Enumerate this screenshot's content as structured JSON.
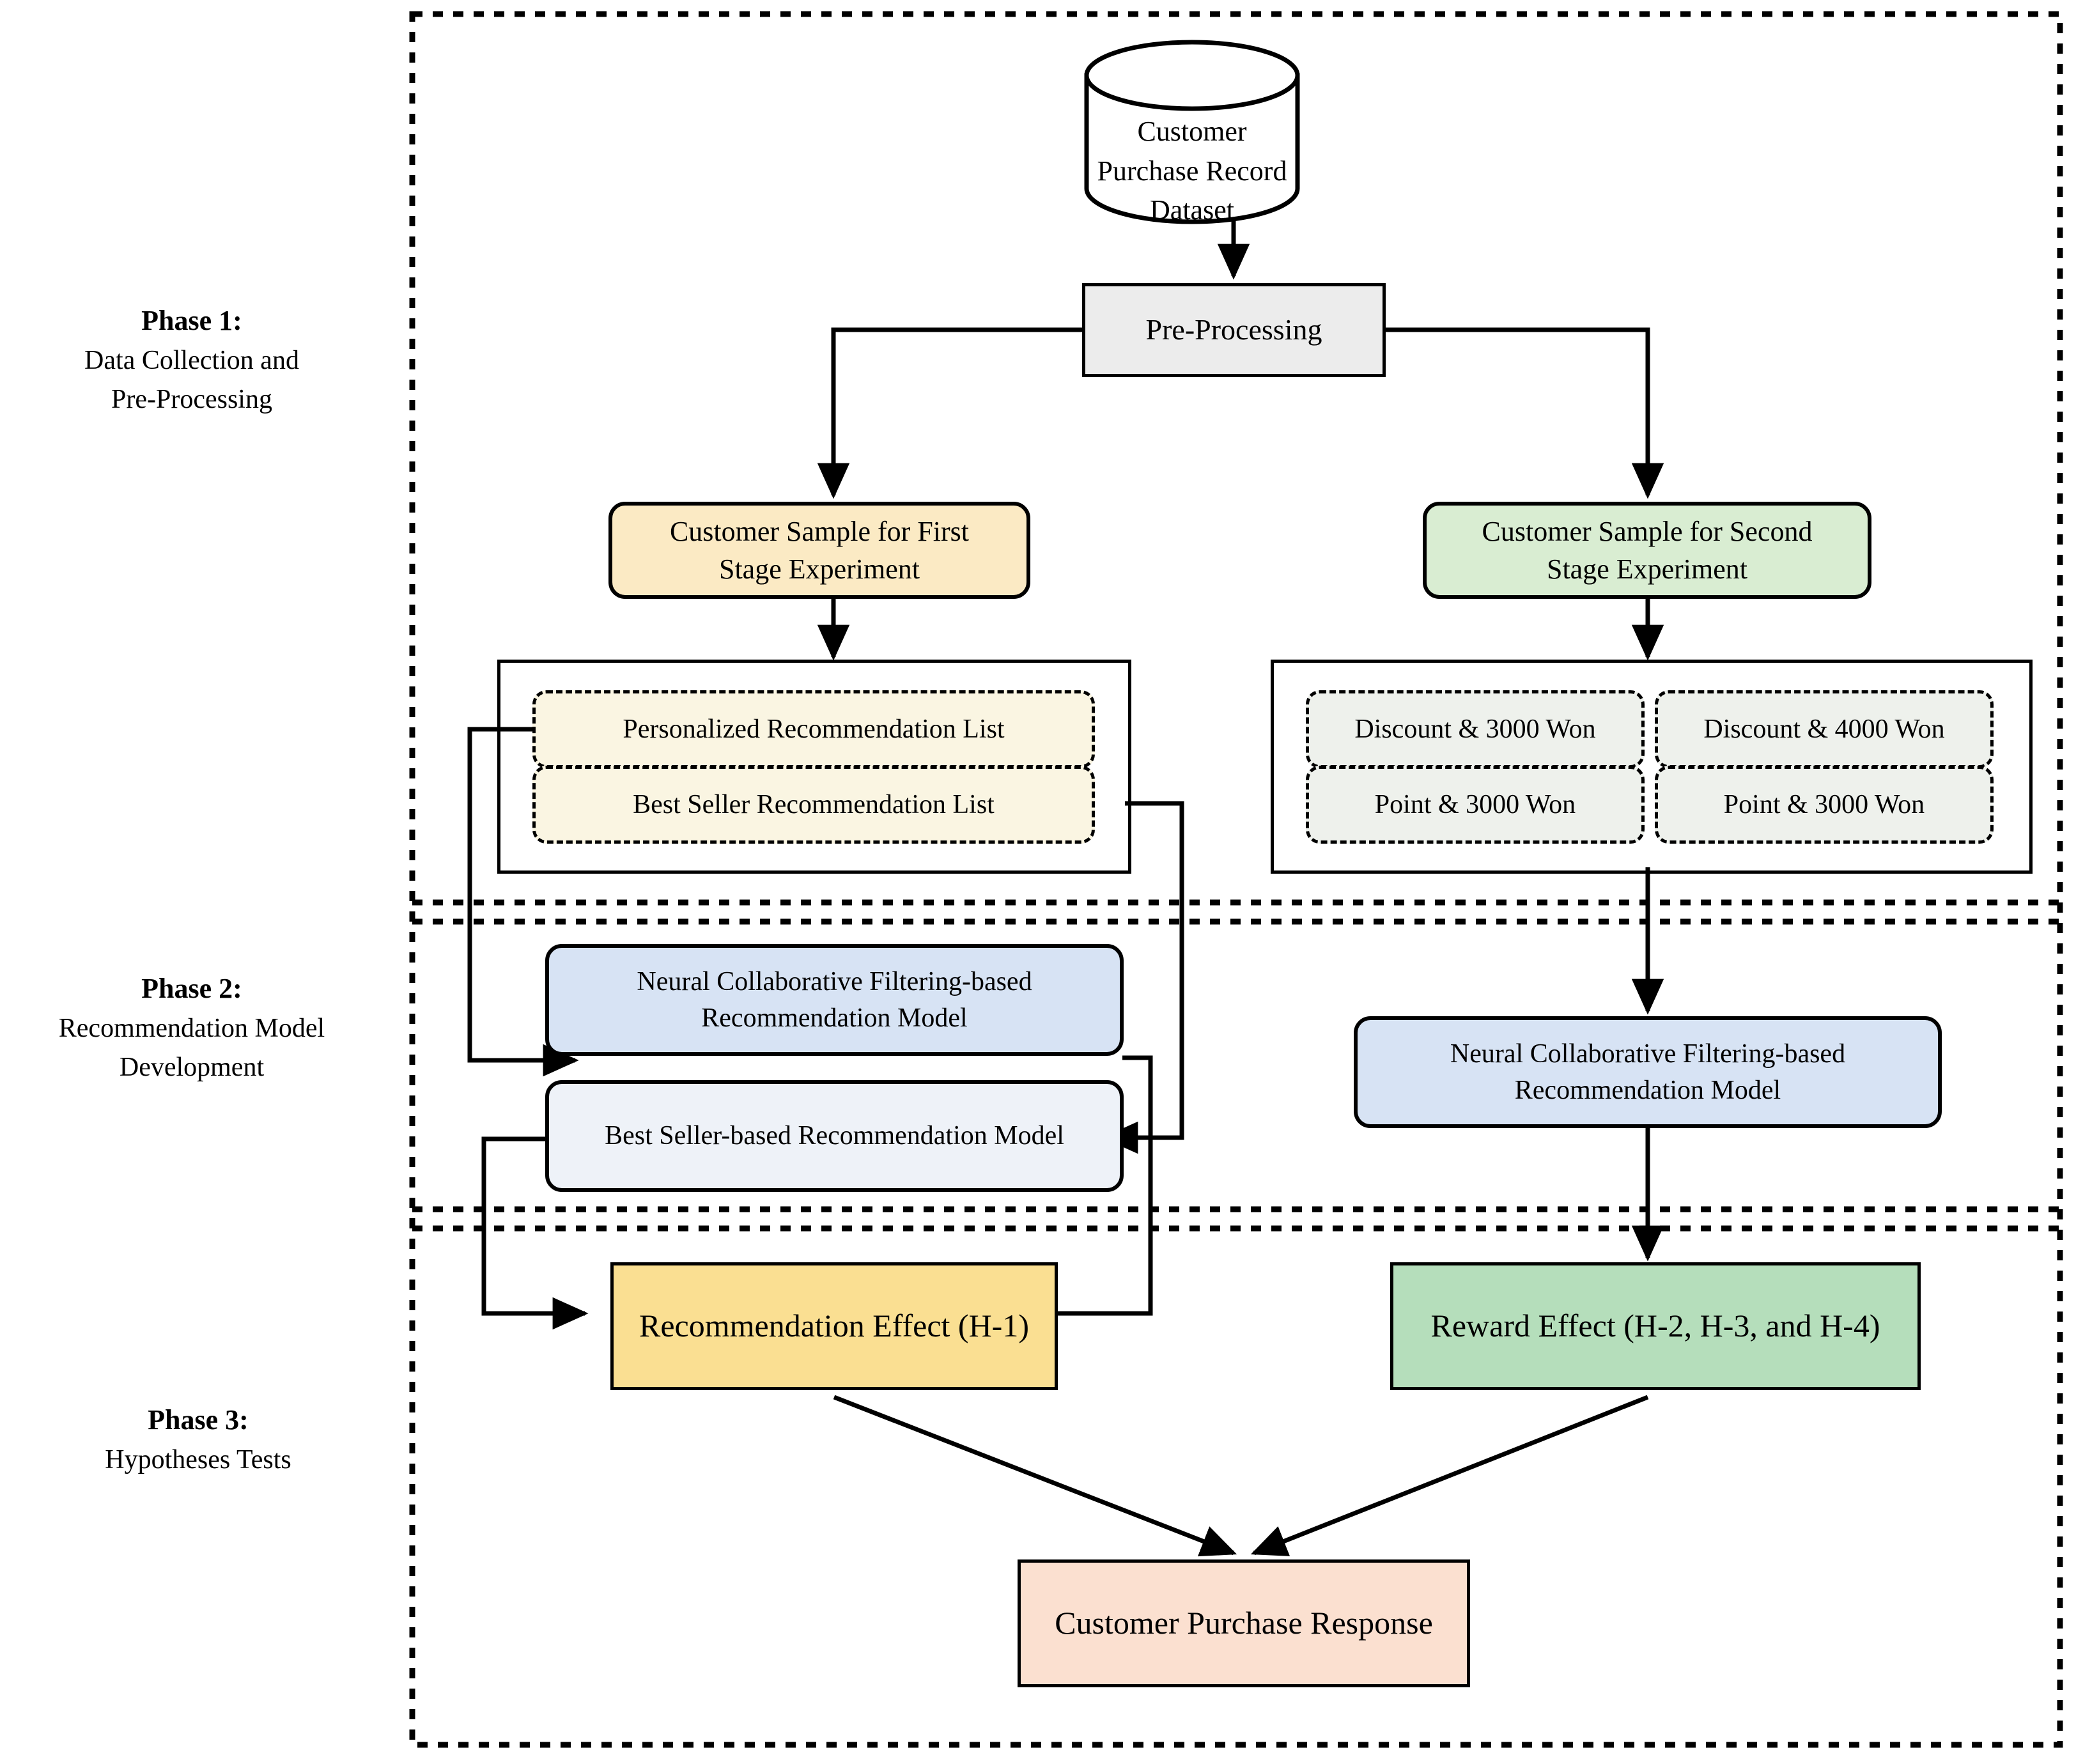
{
  "diagram": {
    "title": "Three-phase research framework for recommendation and reward effects",
    "phases": [
      {
        "id": "phase-1",
        "heading": "Phase 1:",
        "subtitle_lines": [
          "Data Collection and",
          "Pre-Processing"
        ]
      },
      {
        "id": "phase-2",
        "heading": "Phase 2:",
        "subtitle_lines": [
          "Recommendation Model",
          "Development"
        ]
      },
      {
        "id": "phase-3",
        "heading": "Phase 3:",
        "subtitle_lines": [
          "Hypotheses Tests"
        ]
      }
    ],
    "nodes": {
      "dataset": {
        "lines": [
          "Customer Purchase",
          "Record Dataset"
        ],
        "shape": "cylinder",
        "fill": "#ffffff"
      },
      "preprocessing": {
        "label": "Pre-Processing",
        "shape": "rectangle",
        "fill": "#ececec"
      },
      "sample_first": {
        "lines": [
          "Customer Sample for First",
          "Stage Experiment"
        ],
        "shape": "rounded",
        "fill": "#fbeac4"
      },
      "sample_second": {
        "lines": [
          "Customer Sample for Second",
          "Stage Experiment"
        ],
        "shape": "rounded",
        "fill": "#d9edd2"
      },
      "rec_list_personalized": {
        "label": "Personalized Recommendation List",
        "shape": "dashed-rounded",
        "fill": "#faf5e2"
      },
      "rec_list_bestseller": {
        "label": "Best Seller Recommendation List",
        "shape": "dashed-rounded",
        "fill": "#faf5e2"
      },
      "reward_discount_3000": {
        "label": "Discount & 3000 Won",
        "shape": "dashed-rounded",
        "fill": "#eef1ec"
      },
      "reward_discount_4000": {
        "label": "Discount & 4000 Won",
        "shape": "dashed-rounded",
        "fill": "#eef1ec"
      },
      "reward_point_3000_a": {
        "label": "Point & 3000 Won",
        "shape": "dashed-rounded",
        "fill": "#eef1ec"
      },
      "reward_point_3000_b": {
        "label": "Point & 3000 Won",
        "shape": "dashed-rounded",
        "fill": "#eef1ec"
      },
      "ncf_model_left": {
        "lines": [
          "Neural Collaborative Filtering-based",
          "Recommendation Model"
        ],
        "shape": "rounded",
        "fill": "#d7e3f4"
      },
      "bestseller_model": {
        "label": "Best Seller-based Recommendation Model",
        "shape": "rounded",
        "fill": "#eef2f8"
      },
      "ncf_model_right": {
        "lines": [
          "Neural Collaborative Filtering-based",
          "Recommendation Model"
        ],
        "shape": "rounded",
        "fill": "#d7e3f4"
      },
      "recommendation_effect": {
        "label": "Recommendation Effect (H-1)",
        "shape": "rectangle",
        "fill": "#fadf92"
      },
      "reward_effect": {
        "label": "Reward Effect (H-2, H-3, and H-4)",
        "shape": "rectangle",
        "fill": "#b5debb"
      },
      "purchase_response": {
        "label": "Customer Purchase Response",
        "shape": "rectangle",
        "fill": "#fbe0d0"
      }
    },
    "colors": {
      "stroke": "#000000",
      "canvas": "#ffffff",
      "gray_fill": "#ececec",
      "yellow_fill": "#fadf92",
      "cream_fill": "#fbeac4",
      "green_fill": "#b5debb",
      "light_green_fill": "#d9edd2",
      "blue_fill": "#d7e3f4",
      "peach_fill": "#fbe0d0"
    }
  }
}
